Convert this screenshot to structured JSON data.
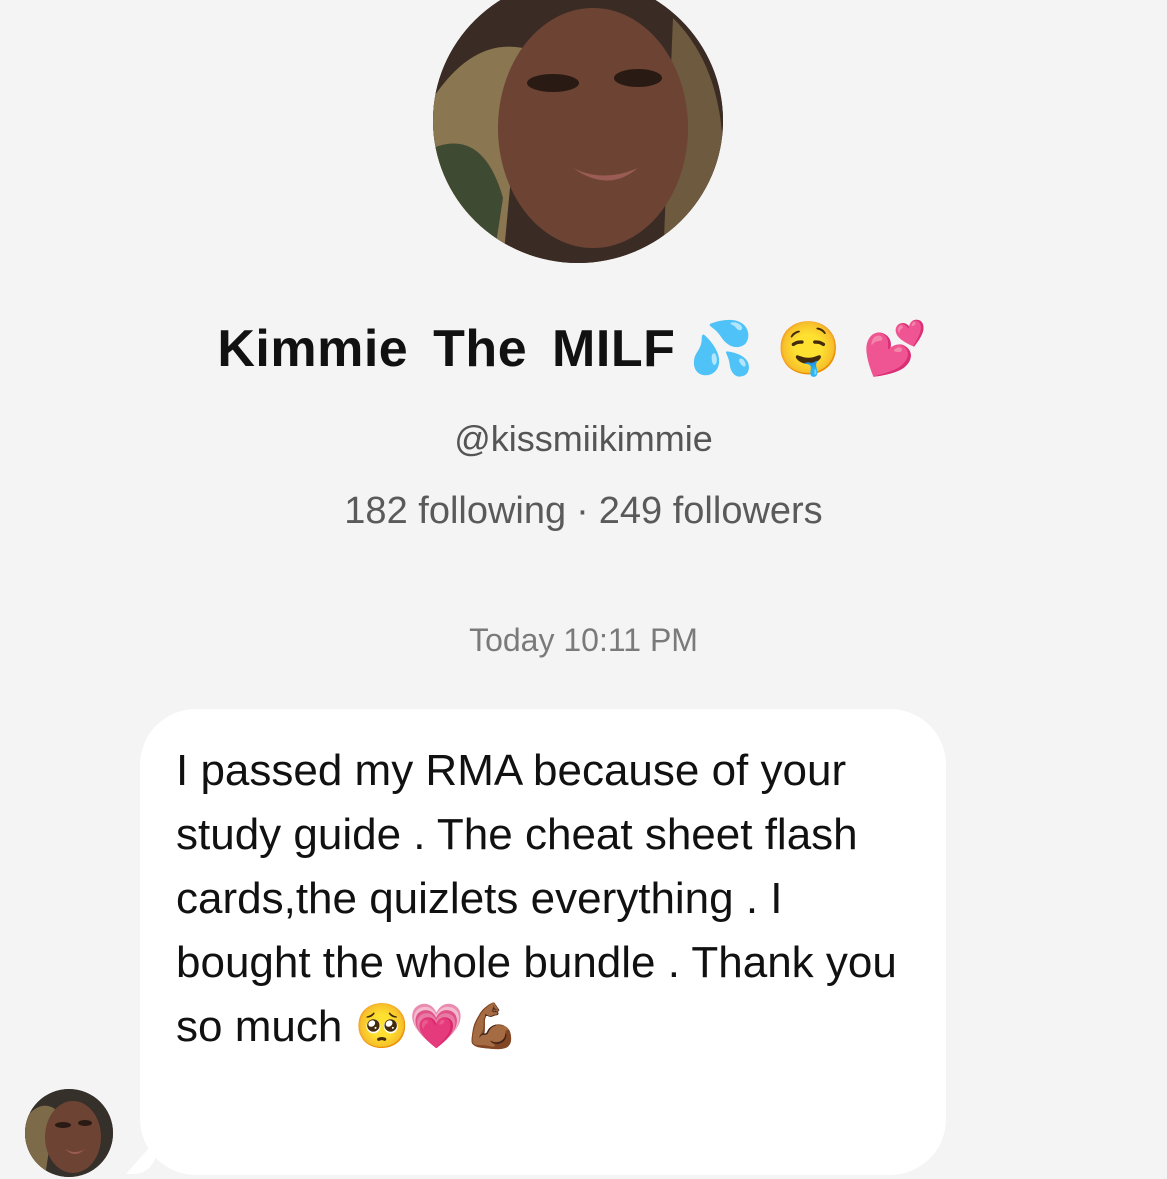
{
  "profile": {
    "name": "Kimmie  The  MILF",
    "name_emojis": "💦🤤💕",
    "handle": "@kissmiikimmie",
    "following_text": "182 following",
    "separator": "·",
    "followers_text": "249 followers"
  },
  "conversation": {
    "timestamp": "Today 10:11 PM",
    "message": "I passed my RMA because of your study guide . The cheat sheet flash cards,the quizlets everything . I bought the whole bundle . Thank you so much 🥺💗💪🏾"
  },
  "icons": {
    "profile_avatar": "profile-photo",
    "sender_avatar": "profile-photo"
  },
  "colors": {
    "background": "#f4f4f4",
    "bubble": "#ffffff",
    "secondary_text": "#5a5a5a",
    "timestamp_text": "#7a7a7a"
  }
}
